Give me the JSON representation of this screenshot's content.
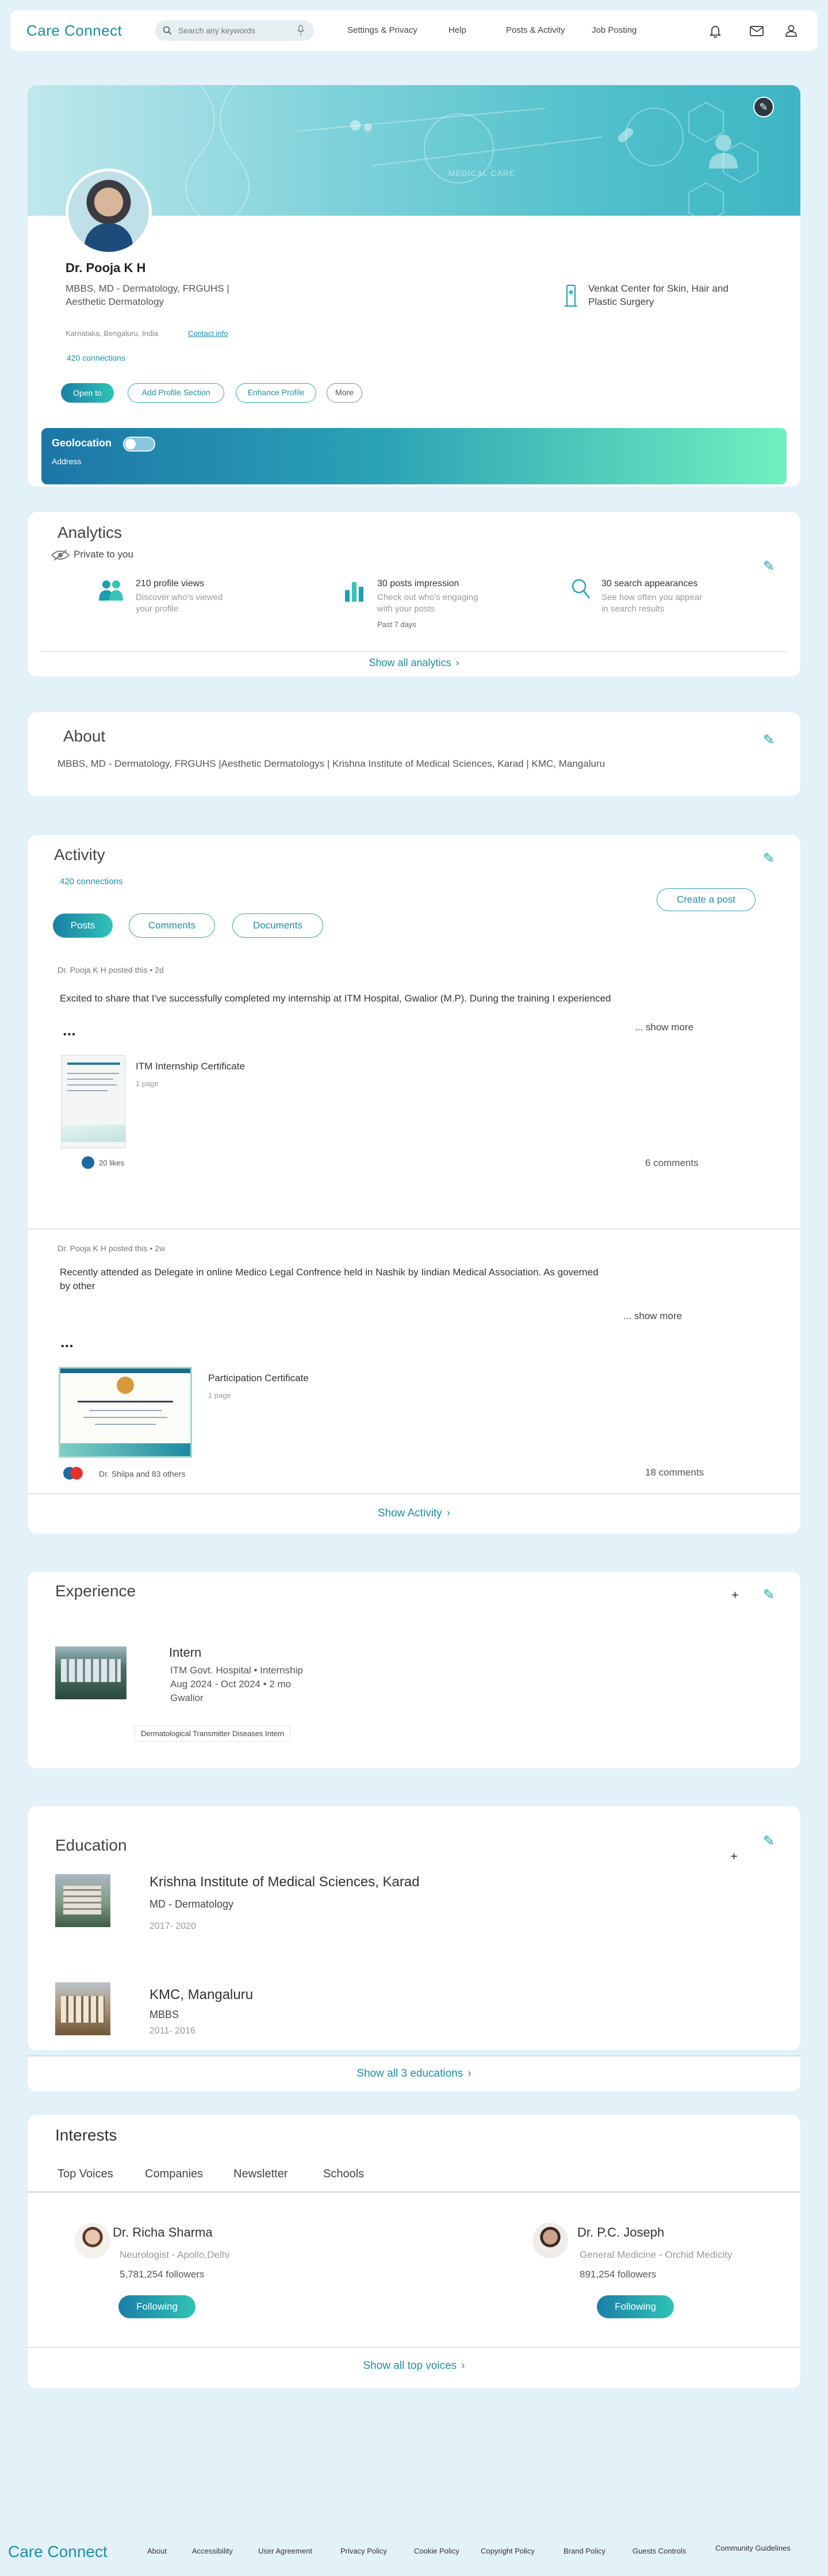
{
  "nav": {
    "logo": "Care Connect",
    "search_placeholder": "Search any keywords",
    "links": [
      "Settings & Privacy",
      "Help",
      "Posts & Activity",
      "Job Posting"
    ]
  },
  "profile": {
    "banner_text": "MEDICAL CARE",
    "name": "Dr. Pooja K H",
    "headline_line1": "MBBS, MD - Dermatology, FRGUHS |",
    "headline_line2": "Aesthetic Dermatology",
    "location": "Karnataka, Bengaluru, India",
    "contact": "Contact info",
    "connections": "420 connections",
    "workplace_line1": "Venkat Center for Skin, Hair and",
    "workplace_line2": "Plastic Surgery",
    "buttons": {
      "open_to": "Open to",
      "add_section": "Add Profile Section",
      "enhance": "Enhance Profile",
      "more": "More"
    },
    "geo_title": "Geolocation",
    "geo_address": "Address"
  },
  "analytics": {
    "title": "Analytics",
    "private": "Private to you",
    "stats": [
      {
        "title": "210 profile views",
        "desc1": "Discover who's viewed",
        "desc2": "your profile"
      },
      {
        "title": "30 posts impression",
        "desc1": "Check out who's engaging",
        "desc2": "with your posts",
        "extra": "Past 7 days"
      },
      {
        "title": "30 search appearances",
        "desc1": "See how often you appear",
        "desc2": "in search results"
      }
    ],
    "show_all": "Show all analytics"
  },
  "about": {
    "title": "About",
    "text": "MBBS, MD - Dermatology, FRGUHS |Aesthetic Dermatologys | Krishna Institute of Medical Sciences, Karad | KMC, Mangaluru"
  },
  "activity": {
    "title": "Activity",
    "connections": "420 connections",
    "create_post": "Create a post",
    "tabs": [
      "Posts",
      "Comments",
      "Documents"
    ],
    "posts": [
      {
        "meta_author": "Dr. Pooja K H posted this",
        "meta_time": "2d",
        "text_line1": "Excited to share that I've successfully completed my internship at ITM Hospital, Gwalior (M.P). During the training I experienced",
        "text_line2": "",
        "show_more": "... show more",
        "dots": "•••",
        "doc_title": "ITM Internship Certificate",
        "doc_pages": "1 page",
        "likes": "20 likes",
        "comments": "6 comments"
      },
      {
        "meta_author": "Dr. Pooja K H  posted this",
        "meta_time": "2w",
        "text_line1": "Recently attended as Delegate in online Medico Legal Confrence held in Nashik by Iindian Medical Association. As governed",
        "text_line2": "by other",
        "show_more": "... show more",
        "dots": "•••",
        "doc_title": "Participation Certificate",
        "doc_pages": "1 page",
        "likes": "Dr. Shilpa and 83 others",
        "comments": "18 comments"
      }
    ],
    "show_activity": "Show Activity"
  },
  "experience": {
    "title": "Experience",
    "role": "Intern",
    "org": "ITM Govt. Hospital • Internship",
    "dates": "Aug 2024 - Oct 2024  • 2 mo",
    "place": "Gwalior",
    "skill": "Dermatological Transmitter Diseases Intern"
  },
  "education": {
    "title": "Education",
    "items": [
      {
        "school": "Krishna Institute of Medical Sciences, Karad",
        "degree": "MD - Dermatology",
        "years": "2017- 2020"
      },
      {
        "school": "KMC, Mangaluru",
        "degree": "MBBS",
        "years": "2011- 2016"
      }
    ],
    "show_all": "Show all 3 educations"
  },
  "interests": {
    "title": "Interests",
    "tabs": [
      "Top Voices",
      "Companies",
      "Newsletter",
      "Schools"
    ],
    "people": [
      {
        "name": "Dr. Richa Sharma",
        "role": "Neurologist - Apollo,Delhi",
        "followers": "5,781,254 followers",
        "button": "Following"
      },
      {
        "name": "Dr. P.C. Joseph",
        "role": "General Medicine - Orchid Medicity",
        "followers": "891,254 followers",
        "button": "Following"
      }
    ],
    "show_all": "Show all top voices"
  },
  "footer": {
    "logo": "Care Connect",
    "links": [
      "About",
      "Accessibility",
      "User Agreement",
      "Privacy Policy",
      "Cookie Policy",
      "Copyright Policy",
      "Brand Policy",
      "Guests Controls",
      "Community Guidelines"
    ]
  }
}
